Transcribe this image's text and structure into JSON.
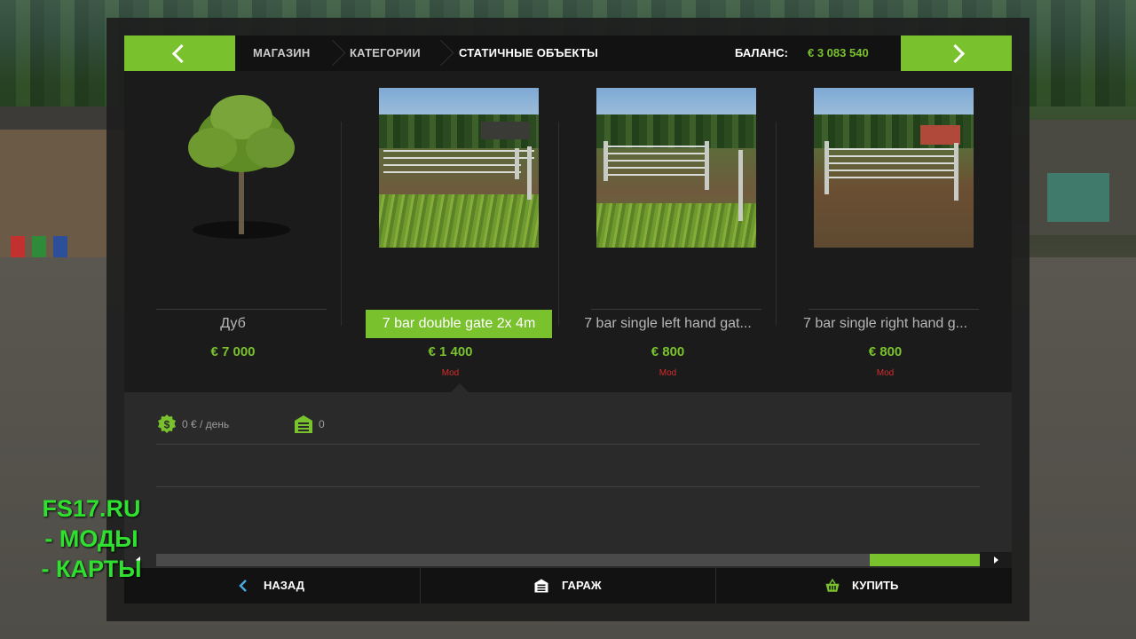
{
  "header": {
    "breadcrumb": [
      "МАГАЗИН",
      "КАТЕГОРИИ",
      "СТАТИЧНЫЕ ОБЪЕКТЫ"
    ],
    "balance_label": "БАЛАНС:",
    "balance_value": "€ 3 083 540"
  },
  "items": [
    {
      "name": "Дуб",
      "price": "€ 7 000",
      "mod": "",
      "selected": false
    },
    {
      "name": "7 bar double gate 2x 4m",
      "price": "€ 1 400",
      "mod": "Mod",
      "selected": true
    },
    {
      "name": "7 bar single left hand gat...",
      "price": "€ 800",
      "mod": "Mod",
      "selected": false
    },
    {
      "name": "7 bar single right hand g...",
      "price": "€ 800",
      "mod": "Mod",
      "selected": false
    }
  ],
  "info": {
    "upkeep": "0 € / день",
    "capacity": "0"
  },
  "footer": {
    "back_label": "НАЗАД",
    "garage_label": "ГАРАЖ",
    "buy_label": "КУПИТЬ"
  },
  "watermark": [
    "FS17.RU",
    "- МОДЫ",
    "- КАРТЫ"
  ],
  "icons": {
    "nav_left": "chevron-left-icon",
    "nav_right": "chevron-right-icon",
    "upkeep": "money-icon",
    "capacity": "garage-icon",
    "back": "chevron-left-icon",
    "garage": "garage-icon",
    "buy": "basket-icon"
  },
  "colors": {
    "accent": "#7ac12e",
    "mod": "#d62b2b",
    "watermark": "#2fe02f"
  }
}
